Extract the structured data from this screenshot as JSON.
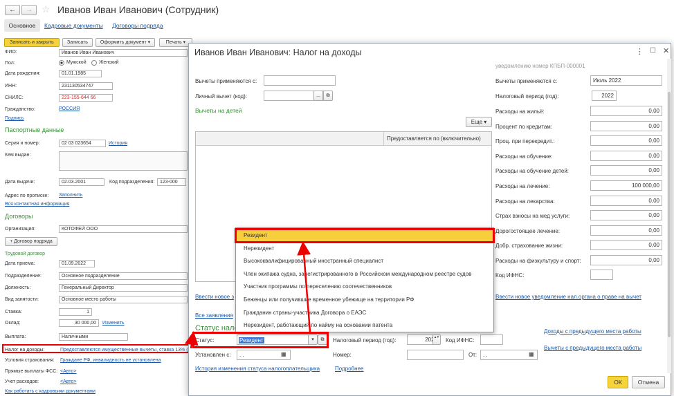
{
  "bg": {
    "back_icon": "←",
    "forward_icon": "→",
    "star_icon": "☆",
    "title": "Иванов Иван Иванович (Сотрудник)",
    "tabs": [
      "Основное",
      "Кадровые документы",
      "Договоры подряда"
    ],
    "toolbar": {
      "save_close": "Записать и закрыть",
      "save": "Записать",
      "create_doc": "Оформить документ ▾",
      "print": "Печать ▾"
    },
    "fields": {
      "fio_label": "ФИО:",
      "fio": "Иванов Иван Иванович",
      "gender_label": "Пол:",
      "gender_male": "Мужской",
      "gender_female": "Женский",
      "birth_label": "Дата рождения:",
      "birth": "01.01.1985",
      "inn_label": "ИНН:",
      "inn": "231130534747",
      "snils_label": "СНИЛС:",
      "snils": "223-155-644 66",
      "citizenship_label": "Гражданство:",
      "citizenship": "РОССИЯ",
      "signature": "Подпись"
    },
    "passport": {
      "header": "Паспортные данные",
      "series_label": "Серия и номер:",
      "series": "02 03 023654",
      "history": "История",
      "issued_by_label": "Кем выдан:",
      "issue_date_label": "Дата выдачи:",
      "issue_date": "02.03.2001",
      "code_label": "Код подразделения:",
      "code": "123-000",
      "address_label": "Адрес по прописке:",
      "address_fill": "Заполнить",
      "contacts": "Вся контактная информация"
    },
    "contracts": {
      "header": "Договоры",
      "org_label": "Организация:",
      "org": "КОТОФЕЙ ООО",
      "add_btn": "+ Договор подряда",
      "labor": "Трудовой договор",
      "hire_label": "Дата приема:",
      "hire": "01.09.2022",
      "dept_label": "Подразделение:",
      "dept": "Основное подразделение",
      "position_label": "Должность:",
      "position": "Генеральный Директор",
      "employment_label": "Вид занятости:",
      "employment": "Основное место работы",
      "rate_label": "Ставка:",
      "rate": "1",
      "salary_label": "Оклад:",
      "salary": "30 000,00",
      "change": "Изменить",
      "payout_label": "Выплата:",
      "payout": "Наличными",
      "tax_label": "Налог на доходы:",
      "tax_link": "Предоставляются имущественные вычеты, ставка 13% (ре",
      "insurance_label": "Условия страхования:",
      "insurance": "Граждане РФ, инвалидность не установлена",
      "fss_label": "Прямые выплаты ФСС:",
      "auto": "<Авто>",
      "expenses_label": "Учет расходов:",
      "howto": "Как работать с кадровыми документами"
    }
  },
  "dialog": {
    "title": "Иванов Иван Иванович: Налог на доходы",
    "win": {
      "more": "⋮",
      "max": "☐",
      "close": "✕"
    },
    "left": {
      "deductions_from": "Вычеты применяются с:",
      "personal_label": "Личный вычет (код):",
      "dots": "...",
      "open_icon": "⧉",
      "children_header": "Вычеты на детей",
      "more": "Еще ▾",
      "col_provided": "Предоставляется по (включительно)",
      "new_statement": "Ввести новое з",
      "all_statements": "Все заявления",
      "status_header": "Статус нало"
    },
    "status": {
      "label": "Статус:",
      "value": "Резидент",
      "arrow": "▾",
      "period_label": "Налоговый период (год):",
      "period": "2022",
      "stepper": "▴ ▾",
      "ifns_label": "Код ИФНС:",
      "from_label": "Установлен с:",
      "date_mask": " .  .",
      "cal": "▦",
      "number_label": "Номер:",
      "from_short": "От:",
      "history": "История изменения статуса налогоплательщика",
      "details": "Подробнее"
    },
    "right": {
      "notice": "уведомлению номер КПБП-000001",
      "deductions_from": "Вычеты применяются с:",
      "month": "Июль 2022",
      "period_label": "Налоговый период (год):",
      "period": "2022",
      "rows": [
        {
          "label": "Расходы на жильё:",
          "value": "0,00"
        },
        {
          "label": "Процент по кредитам:",
          "value": "0,00"
        },
        {
          "label": "Проц. при перекредит.:",
          "value": "0,00"
        },
        {
          "label": "Расходы на обучение:",
          "value": "0,00"
        },
        {
          "label": "Расходы на обучение детей:",
          "value": "0,00"
        },
        {
          "label": "Расходы на лечение:",
          "value": "100 000,00"
        },
        {
          "label": "Расходы на лекарства:",
          "value": "0,00"
        },
        {
          "label": "Страх взносы на мед услуги:",
          "value": "0,00"
        },
        {
          "label": "Дорогостоящее лечение:",
          "value": "0,00"
        },
        {
          "label": "Добр. страхование жизни:",
          "value": "0,00"
        },
        {
          "label": "Расходы на физкультуру и спорт:",
          "value": "0,00"
        }
      ],
      "ifns_label": "Код ИФНС:",
      "new_notice": "Ввести новое уведомление нал.органа о праве на вычет",
      "income_prev": "Доходы с предыдущего места работы",
      "deductions_prev": "Вычеты с предыдущего места работы"
    },
    "ok": "ОК",
    "cancel": "Отмена"
  },
  "dropdown": {
    "items": [
      "Резидент",
      "Нерезидент",
      "Высококвалифицированный иностранный специалист",
      "Член экипажа судна, зарегистрированного в Российском международном реестре судов",
      "Участник программы по переселению соотечественников",
      "Беженцы или получившие временное убежище на территории РФ",
      "Гражданин страны-участника Договора о ЕАЭС",
      "Нерезидент, работающий по найму на основании патента"
    ]
  }
}
